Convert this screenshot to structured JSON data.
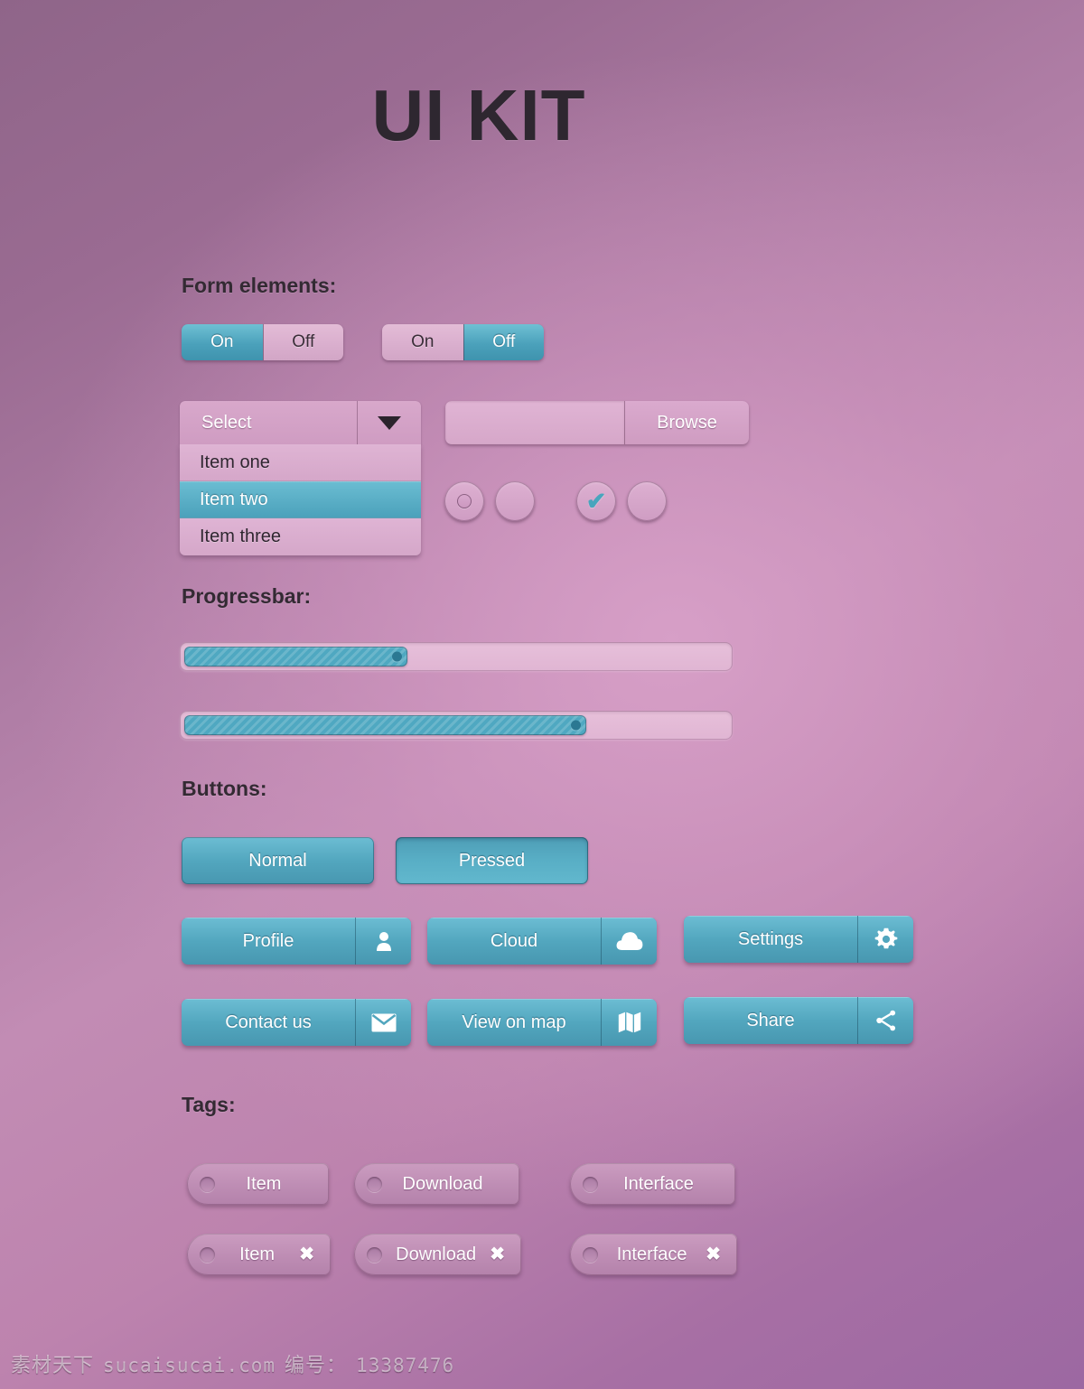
{
  "page": {
    "title": "UI KIT",
    "background_top_color": "#8f6589",
    "background_center_color": "#c994b8",
    "background_bottom_color": "#9c68a2",
    "accent_color": "#52a6be",
    "surface_color": "#d8a8cb"
  },
  "sections": {
    "form": "Form elements:",
    "progress": "Progressbar:",
    "buttons": "Buttons:",
    "tags": "Tags:"
  },
  "toggles": [
    {
      "on_label": "On",
      "off_label": "Off",
      "state": "on"
    },
    {
      "on_label": "On",
      "off_label": "Off",
      "state": "off"
    }
  ],
  "select": {
    "value": "Select",
    "caret_icon": "chevron-down-icon",
    "options": [
      {
        "label": "Item one",
        "selected": false
      },
      {
        "label": "Item two",
        "selected": true
      },
      {
        "label": "Item three",
        "selected": false
      }
    ]
  },
  "file_picker": {
    "value": "",
    "placeholder": "",
    "browse_label": "Browse"
  },
  "choices": [
    {
      "type": "radio",
      "name": "radio-selected",
      "checked": true
    },
    {
      "type": "radio",
      "name": "radio-unselected",
      "checked": false
    },
    {
      "type": "checkbox",
      "name": "checkbox-checked",
      "checked": true,
      "mark": "✔"
    },
    {
      "type": "checkbox",
      "name": "checkbox-unchecked",
      "checked": false,
      "mark": ""
    }
  ],
  "progressbars": [
    {
      "name": "progressbar-one",
      "percent": 41
    },
    {
      "name": "progressbar-two",
      "percent": 74
    }
  ],
  "buttons": {
    "normal": "Normal",
    "pressed": "Pressed",
    "split": [
      {
        "label": "Profile",
        "icon": "user-icon"
      },
      {
        "label": "Cloud",
        "icon": "cloud-icon"
      },
      {
        "label": "Settings",
        "icon": "gear-icon"
      },
      {
        "label": "Contact us",
        "icon": "mail-icon"
      },
      {
        "label": "View on map",
        "icon": "map-icon"
      },
      {
        "label": "Share",
        "icon": "share-icon"
      }
    ]
  },
  "tags": {
    "row_plain": [
      {
        "label": "Item"
      },
      {
        "label": "Download"
      },
      {
        "label": "Interface"
      }
    ],
    "row_closable": [
      {
        "label": "Item",
        "close": "✖"
      },
      {
        "label": "Download",
        "close": "✖"
      },
      {
        "label": "Interface",
        "close": "✖"
      }
    ]
  },
  "watermark": {
    "site_cn": "素材天下",
    "site": "sucaisucai.com",
    "id_label": "编号：",
    "id_value": "13387476"
  }
}
